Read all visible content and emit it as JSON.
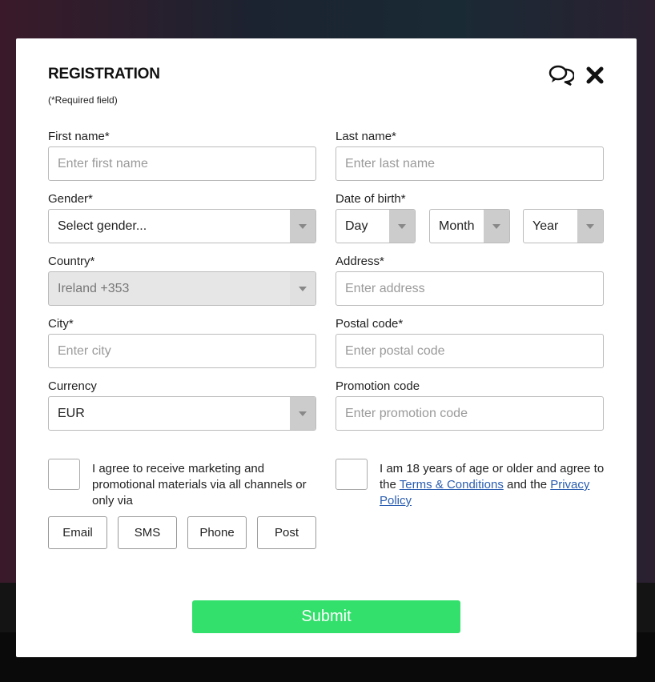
{
  "modal": {
    "title": "REGISTRATION",
    "required_note": "(*Required field)",
    "icons": {
      "chat": "chat-bubbles-icon",
      "close": "close-x-icon"
    }
  },
  "fields": {
    "first_name": {
      "label": "First name*",
      "placeholder": "Enter first name"
    },
    "last_name": {
      "label": "Last name*",
      "placeholder": "Enter last name"
    },
    "gender": {
      "label": "Gender*",
      "value": "Select gender..."
    },
    "dob": {
      "label": "Date of birth*",
      "day": "Day",
      "month": "Month",
      "year": "Year"
    },
    "country": {
      "label": "Country*",
      "value": "Ireland +353"
    },
    "address": {
      "label": "Address*",
      "placeholder": "Enter address"
    },
    "city": {
      "label": "City*",
      "placeholder": "Enter city"
    },
    "postal": {
      "label": "Postal code*",
      "placeholder": "Enter postal code"
    },
    "currency": {
      "label": "Currency",
      "value": "EUR"
    },
    "promo": {
      "label": "Promotion code",
      "placeholder": "Enter promotion code"
    }
  },
  "consent": {
    "marketing_text": "I agree to receive marketing and promotional materials via all channels or only via",
    "age_text_before": "I am 18 years of age or older and agree to the",
    "terms_link": "Terms & Conditions",
    "and_the": "and the",
    "privacy_link": "Privacy Policy",
    "channels": [
      "Email",
      "SMS",
      "Phone",
      "Post"
    ]
  },
  "submit_label": "Submit",
  "colors": {
    "submit": "#33e06c",
    "link": "#2a5db0"
  }
}
